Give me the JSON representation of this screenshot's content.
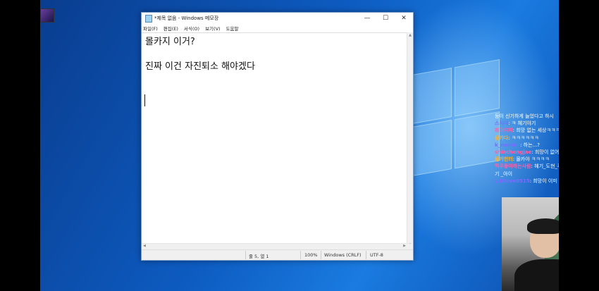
{
  "desktop": {
    "icon_label": ""
  },
  "notepad": {
    "title": "*제목 없음 - Windows 메모장",
    "controls": {
      "minimize": "—",
      "maximize": "☐",
      "close": "✕"
    },
    "menu": [
      "파일(F)",
      "편집(E)",
      "서식(O)",
      "보기(V)",
      "도움말"
    ],
    "lines": [
      "몰카지 이거?",
      "진짜 이건 자진퇴소 해야겠다"
    ],
    "status": {
      "position": "줄 5, 열 1",
      "zoom": "100%",
      "line_ending": "Windows (CRLF)",
      "encoding": "UTF-8"
    }
  },
  "chat": [
    {
      "nick": "",
      "text": "등이 신기하게 늘었다고 하시",
      "nick_color": "#bcd"
    },
    {
      "nick": "스시다",
      "text": "ㅋ 헤기야기",
      "nick_color": "#7a6cff"
    },
    {
      "nick": "레이디피",
      "text": "희망 없는 세상ㅋㅋㅋㅋ",
      "nick_color": "#ff5fa8"
    },
    {
      "nick": "몰카다",
      "text": "ㅋㅋㅋㅋㅋㅋ",
      "nick_color": "#ffb020"
    },
    {
      "nick": "k_nomdi_",
      "text": "하는...?",
      "nick_color": "#7a6cff"
    },
    {
      "nick": "shinchongjae",
      "text": "희망이 없어..",
      "nick_color": "#ff5fa8"
    },
    {
      "nick": "몰카헌터",
      "text": "몰카야 ㅋㅋㅋㅋ",
      "nick_color": "#ffb020"
    },
    {
      "nick": "맥주좋아하는사람",
      "text": "헤기_도현_푸",
      "nick_color": "#ff5fa8"
    },
    {
      "nick": "",
      "text": "기 _아이",
      "nick_color": "#fff"
    },
    {
      "nick": "ydclove0515",
      "text": "희망이 이미 없다",
      "nick_color": "#7a6cff"
    }
  ]
}
